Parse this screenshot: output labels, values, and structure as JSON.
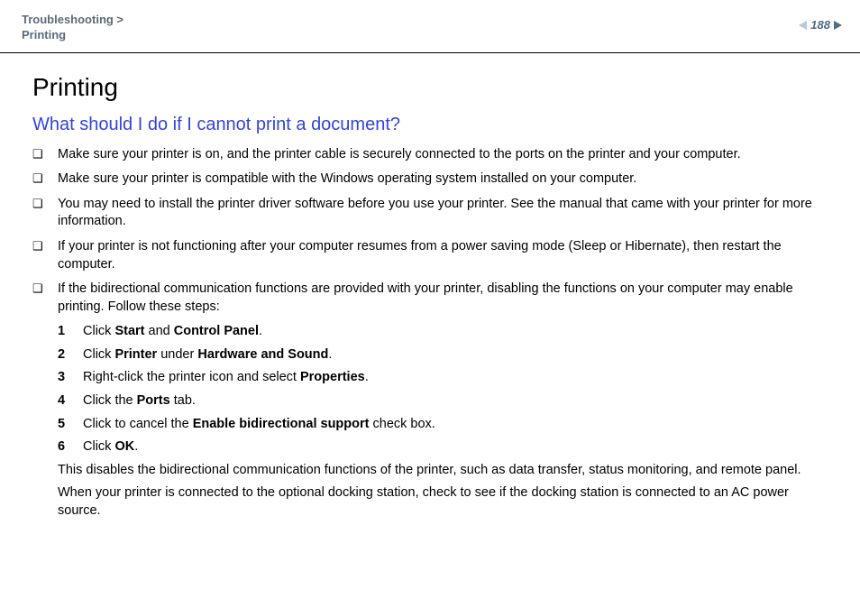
{
  "header": {
    "breadcrumb_parent": "Troubleshooting >",
    "breadcrumb_child": "Printing",
    "page_number": "188"
  },
  "main": {
    "title": "Printing",
    "subtitle": "What should I do if I cannot print a document?",
    "bullets": [
      "Make sure your printer is on, and the printer cable is securely connected to the ports on the printer and your computer.",
      "Make sure your printer is compatible with the Windows operating system installed on your computer.",
      "You may need to install the printer driver software before you use your printer. See the manual that came with your printer for more information.",
      "If your printer is not functioning after your computer resumes from a power saving mode (Sleep or Hibernate), then restart the computer.",
      "If the bidirectional communication functions are provided with your printer, disabling the functions on your computer may enable printing. Follow these steps:"
    ],
    "steps": [
      {
        "n": "1",
        "pre": "Click ",
        "b1": "Start",
        "mid": " and ",
        "b2": "Control Panel",
        "post": "."
      },
      {
        "n": "2",
        "pre": "Click ",
        "b1": "Printer",
        "mid": " under ",
        "b2": "Hardware and Sound",
        "post": "."
      },
      {
        "n": "3",
        "pre": "Right-click the printer icon and select ",
        "b1": "Properties",
        "mid": "",
        "b2": "",
        "post": "."
      },
      {
        "n": "4",
        "pre": "Click the ",
        "b1": "Ports",
        "mid": "",
        "b2": "",
        "post": " tab."
      },
      {
        "n": "5",
        "pre": "Click to cancel the ",
        "b1": "Enable bidirectional support",
        "mid": "",
        "b2": "",
        "post": " check box."
      },
      {
        "n": "6",
        "pre": "Click ",
        "b1": "OK",
        "mid": "",
        "b2": "",
        "post": "."
      }
    ],
    "after1": "This disables the bidirectional communication functions of the printer, such as data transfer, status monitoring, and remote panel.",
    "after2": "When your printer is connected to the optional docking station, check to see if the docking station is connected to an AC power source."
  }
}
